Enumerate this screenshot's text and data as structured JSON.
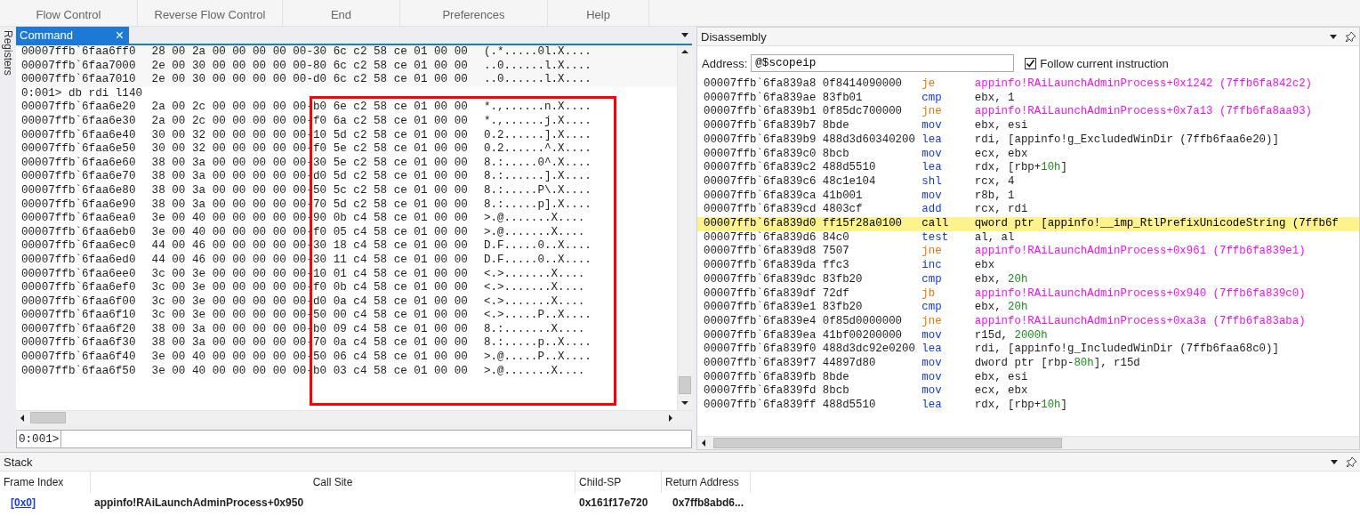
{
  "ribbon": {
    "groups": [
      "Flow Control",
      "Reverse Flow Control",
      "End",
      "Preferences",
      "Help"
    ]
  },
  "side_tabs": [
    "Registers"
  ],
  "command": {
    "tab": "Command",
    "close": "×",
    "prompt": "0:001>",
    "lines": [
      {
        "kind": "dump",
        "address": "00007ffb`6faa6ff0",
        "bytes": "28 00 2a 00 00 00 00 00-30 6c c2 58 ce 01 00 00",
        "ascii": "(.*.....0l.X...."
      },
      {
        "kind": "dump",
        "address": "00007ffb`6faa7000",
        "bytes": "2e 00 30 00 00 00 00 00-80 6c c2 58 ce 01 00 00",
        "ascii": "..0......l.X...."
      },
      {
        "kind": "dump",
        "address": "00007ffb`6faa7010",
        "bytes": "2e 00 30 00 00 00 00 00-d0 6c c2 58 ce 01 00 00",
        "ascii": "..0......l.X...."
      },
      {
        "kind": "command",
        "text": "0:001> db rdi l140"
      },
      {
        "kind": "dump",
        "address": "00007ffb`6faa6e20",
        "bytes": "2a 00 2c 00 00 00 00 00-b0 6e c2 58 ce 01 00 00",
        "ascii": "*.,......n.X...."
      },
      {
        "kind": "dump",
        "address": "00007ffb`6faa6e30",
        "bytes": "2a 00 2c 00 00 00 00 00-f0 6a c2 58 ce 01 00 00",
        "ascii": "*.,......j.X...."
      },
      {
        "kind": "dump",
        "address": "00007ffb`6faa6e40",
        "bytes": "30 00 32 00 00 00 00 00-10 5d c2 58 ce 01 00 00",
        "ascii": "0.2......].X...."
      },
      {
        "kind": "dump",
        "address": "00007ffb`6faa6e50",
        "bytes": "30 00 32 00 00 00 00 00-f0 5e c2 58 ce 01 00 00",
        "ascii": "0.2......^.X...."
      },
      {
        "kind": "dump",
        "address": "00007ffb`6faa6e60",
        "bytes": "38 00 3a 00 00 00 00 00-30 5e c2 58 ce 01 00 00",
        "ascii": "8.:.....0^.X...."
      },
      {
        "kind": "dump",
        "address": "00007ffb`6faa6e70",
        "bytes": "38 00 3a 00 00 00 00 00-d0 5d c2 58 ce 01 00 00",
        "ascii": "8.:......].X...."
      },
      {
        "kind": "dump",
        "address": "00007ffb`6faa6e80",
        "bytes": "38 00 3a 00 00 00 00 00-50 5c c2 58 ce 01 00 00",
        "ascii": "8.:.....P\\.X...."
      },
      {
        "kind": "dump",
        "address": "00007ffb`6faa6e90",
        "bytes": "38 00 3a 00 00 00 00 00-70 5d c2 58 ce 01 00 00",
        "ascii": "8.:.....p].X...."
      },
      {
        "kind": "dump",
        "address": "00007ffb`6faa6ea0",
        "bytes": "3e 00 40 00 00 00 00 00-90 0b c4 58 ce 01 00 00",
        "ascii": ">.@.......X...."
      },
      {
        "kind": "dump",
        "address": "00007ffb`6faa6eb0",
        "bytes": "3e 00 40 00 00 00 00 00-f0 05 c4 58 ce 01 00 00",
        "ascii": ">.@.......X...."
      },
      {
        "kind": "dump",
        "address": "00007ffb`6faa6ec0",
        "bytes": "44 00 46 00 00 00 00 00-30 18 c4 58 ce 01 00 00",
        "ascii": "D.F.....0..X...."
      },
      {
        "kind": "dump",
        "address": "00007ffb`6faa6ed0",
        "bytes": "44 00 46 00 00 00 00 00-30 11 c4 58 ce 01 00 00",
        "ascii": "D.F.....0..X...."
      },
      {
        "kind": "dump",
        "address": "00007ffb`6faa6ee0",
        "bytes": "3c 00 3e 00 00 00 00 00-10 01 c4 58 ce 01 00 00",
        "ascii": "<.>.......X...."
      },
      {
        "kind": "dump",
        "address": "00007ffb`6faa6ef0",
        "bytes": "3c 00 3e 00 00 00 00 00-f0 0b c4 58 ce 01 00 00",
        "ascii": "<.>.......X...."
      },
      {
        "kind": "dump",
        "address": "00007ffb`6faa6f00",
        "bytes": "3c 00 3e 00 00 00 00 00-d0 0a c4 58 ce 01 00 00",
        "ascii": "<.>.......X...."
      },
      {
        "kind": "dump",
        "address": "00007ffb`6faa6f10",
        "bytes": "3c 00 3e 00 00 00 00 00-50 00 c4 58 ce 01 00 00",
        "ascii": "<.>.....P..X...."
      },
      {
        "kind": "dump",
        "address": "00007ffb`6faa6f20",
        "bytes": "38 00 3a 00 00 00 00 00-b0 09 c4 58 ce 01 00 00",
        "ascii": "8.:.......X...."
      },
      {
        "kind": "dump",
        "address": "00007ffb`6faa6f30",
        "bytes": "38 00 3a 00 00 00 00 00-70 0a c4 58 ce 01 00 00",
        "ascii": "8.:.....p..X...."
      },
      {
        "kind": "dump",
        "address": "00007ffb`6faa6f40",
        "bytes": "3e 00 40 00 00 00 00 00-50 06 c4 58 ce 01 00 00",
        "ascii": ">.@.....P..X...."
      },
      {
        "kind": "dump",
        "address": "00007ffb`6faa6f50",
        "bytes": "3e 00 40 00 00 00 00 00-b0 03 c4 58 ce 01 00 00",
        "ascii": ">.@.......X...."
      }
    ]
  },
  "disassembly": {
    "title": "Disassembly",
    "address_label": "Address:",
    "address_value": "@$scopeip",
    "follow": {
      "label": "Follow current instruction",
      "checked": true
    },
    "rows": [
      {
        "address": "00007ffb`6fa839a8",
        "opcode": "0f8414090000",
        "mnemonic": "je",
        "kind": "branch",
        "current": false,
        "operand": [
          {
            "text": "appinfo!RAiLaunchAdminProcess+0x1242 (7ffb6fa842c2)",
            "kind": "symbol"
          }
        ]
      },
      {
        "address": "00007ffb`6fa839ae",
        "opcode": "83fb01",
        "mnemonic": "cmp",
        "kind": "op",
        "current": false,
        "operand": [
          {
            "text": "ebx, 1",
            "kind": "plain"
          }
        ]
      },
      {
        "address": "00007ffb`6fa839b1",
        "opcode": "0f85dc700000",
        "mnemonic": "jne",
        "kind": "branch",
        "current": false,
        "operand": [
          {
            "text": "appinfo!RAiLaunchAdminProcess+0x7a13 (7ffb6fa8aa93)",
            "kind": "symbol"
          }
        ]
      },
      {
        "address": "00007ffb`6fa839b7",
        "opcode": "8bde",
        "mnemonic": "mov",
        "kind": "op",
        "current": false,
        "operand": [
          {
            "text": "ebx, esi",
            "kind": "plain"
          }
        ]
      },
      {
        "address": "00007ffb`6fa839b9",
        "opcode": "488d3d60340200",
        "mnemonic": "lea",
        "kind": "op",
        "current": false,
        "operand": [
          {
            "text": "rdi, [appinfo!g_ExcludedWinDir (7ffb6faa6e20)]",
            "kind": "plain"
          }
        ]
      },
      {
        "address": "00007ffb`6fa839c0",
        "opcode": "8bcb",
        "mnemonic": "mov",
        "kind": "op",
        "current": false,
        "operand": [
          {
            "text": "ecx, ebx",
            "kind": "plain"
          }
        ]
      },
      {
        "address": "00007ffb`6fa839c2",
        "opcode": "488d5510",
        "mnemonic": "lea",
        "kind": "op",
        "current": false,
        "operand": [
          {
            "text": "rdx, [rbp+",
            "kind": "plain"
          },
          {
            "text": "10h",
            "kind": "number"
          },
          {
            "text": "]",
            "kind": "plain"
          }
        ]
      },
      {
        "address": "00007ffb`6fa839c6",
        "opcode": "48c1e104",
        "mnemonic": "shl",
        "kind": "op",
        "current": false,
        "operand": [
          {
            "text": "rcx, 4",
            "kind": "plain"
          }
        ]
      },
      {
        "address": "00007ffb`6fa839ca",
        "opcode": "41b001",
        "mnemonic": "mov",
        "kind": "op",
        "current": false,
        "operand": [
          {
            "text": "r8b, 1",
            "kind": "plain"
          }
        ]
      },
      {
        "address": "00007ffb`6fa839cd",
        "opcode": "4803cf",
        "mnemonic": "add",
        "kind": "op",
        "current": false,
        "operand": [
          {
            "text": "rcx, rdi",
            "kind": "plain"
          }
        ]
      },
      {
        "address": "00007ffb`6fa839d0",
        "opcode": "ff15f28a0100",
        "mnemonic": "call",
        "kind": "op",
        "current": true,
        "operand": [
          {
            "text": "qword ptr [appinfo!__imp_RtlPrefixUnicodeString (7ffb6f",
            "kind": "plain"
          }
        ]
      },
      {
        "address": "00007ffb`6fa839d6",
        "opcode": "84c0",
        "mnemonic": "test",
        "kind": "op",
        "current": false,
        "operand": [
          {
            "text": "al, al",
            "kind": "plain"
          }
        ]
      },
      {
        "address": "00007ffb`6fa839d8",
        "opcode": "7507",
        "mnemonic": "jne",
        "kind": "branch",
        "current": false,
        "operand": [
          {
            "text": "appinfo!RAiLaunchAdminProcess+0x961 (7ffb6fa839e1)",
            "kind": "symbol"
          }
        ]
      },
      {
        "address": "00007ffb`6fa839da",
        "opcode": "ffc3",
        "mnemonic": "inc",
        "kind": "op",
        "current": false,
        "operand": [
          {
            "text": "ebx",
            "kind": "plain"
          }
        ]
      },
      {
        "address": "00007ffb`6fa839dc",
        "opcode": "83fb20",
        "mnemonic": "cmp",
        "kind": "op",
        "current": false,
        "operand": [
          {
            "text": "ebx, ",
            "kind": "plain"
          },
          {
            "text": "20h",
            "kind": "number"
          }
        ]
      },
      {
        "address": "00007ffb`6fa839df",
        "opcode": "72df",
        "mnemonic": "jb",
        "kind": "branch",
        "current": false,
        "operand": [
          {
            "text": "appinfo!RAiLaunchAdminProcess+0x940 (7ffb6fa839c0)",
            "kind": "symbol"
          }
        ]
      },
      {
        "address": "00007ffb`6fa839e1",
        "opcode": "83fb20",
        "mnemonic": "cmp",
        "kind": "op",
        "current": false,
        "operand": [
          {
            "text": "ebx, ",
            "kind": "plain"
          },
          {
            "text": "20h",
            "kind": "number"
          }
        ]
      },
      {
        "address": "00007ffb`6fa839e4",
        "opcode": "0f85d0000000",
        "mnemonic": "jne",
        "kind": "branch",
        "current": false,
        "operand": [
          {
            "text": "appinfo!RAiLaunchAdminProcess+0xa3a (7ffb6fa83aba)",
            "kind": "symbol"
          }
        ]
      },
      {
        "address": "00007ffb`6fa839ea",
        "opcode": "41bf00200000",
        "mnemonic": "mov",
        "kind": "op",
        "current": false,
        "operand": [
          {
            "text": "r15d, ",
            "kind": "plain"
          },
          {
            "text": "2000h",
            "kind": "number"
          }
        ]
      },
      {
        "address": "00007ffb`6fa839f0",
        "opcode": "488d3dc92e0200",
        "mnemonic": "lea",
        "kind": "op",
        "current": false,
        "operand": [
          {
            "text": "rdi, [appinfo!g_IncludedWinDir (7ffb6faa68c0)]",
            "kind": "plain"
          }
        ]
      },
      {
        "address": "00007ffb`6fa839f7",
        "opcode": "44897d80",
        "mnemonic": "mov",
        "kind": "op",
        "current": false,
        "operand": [
          {
            "text": "dword ptr [rbp-",
            "kind": "plain"
          },
          {
            "text": "80h",
            "kind": "number"
          },
          {
            "text": "], r15d",
            "kind": "plain"
          }
        ]
      },
      {
        "address": "00007ffb`6fa839fb",
        "opcode": "8bde",
        "mnemonic": "mov",
        "kind": "op",
        "current": false,
        "operand": [
          {
            "text": "ebx, esi",
            "kind": "plain"
          }
        ]
      },
      {
        "address": "00007ffb`6fa839fd",
        "opcode": "8bcb",
        "mnemonic": "mov",
        "kind": "op",
        "current": false,
        "operand": [
          {
            "text": "ecx, ebx",
            "kind": "plain"
          }
        ]
      },
      {
        "address": "00007ffb`6fa839ff",
        "opcode": "488d5510",
        "mnemonic": "lea",
        "kind": "op",
        "current": false,
        "operand": [
          {
            "text": "rdx, [rbp+",
            "kind": "plain"
          },
          {
            "text": "10h",
            "kind": "number"
          },
          {
            "text": "]",
            "kind": "plain"
          }
        ]
      }
    ]
  },
  "stack": {
    "title": "Stack",
    "columns": [
      "Frame Index",
      "Call Site",
      "Child-SP",
      "Return Address"
    ],
    "rows": [
      {
        "frame_index": "[0x0]",
        "call_site": "appinfo!RAiLaunchAdminProcess+0x950",
        "child_sp": "0x161f17e720",
        "return_address": "0x7ffb8abd6..."
      }
    ]
  }
}
